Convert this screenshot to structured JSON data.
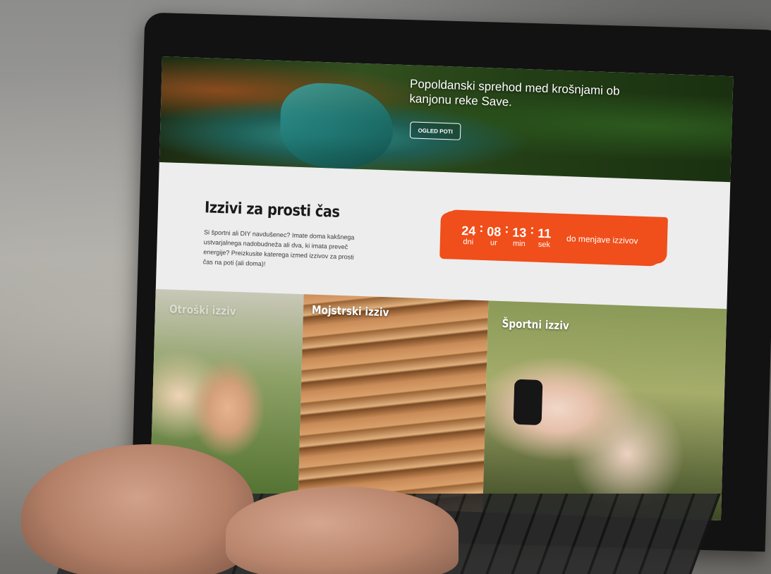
{
  "hero": {
    "title": "Popoldanski sprehod med krošnjami ob kanjonu reke Save.",
    "button_label": "OGLED POTI"
  },
  "intro": {
    "title": "Izzivi za prosti čas",
    "text": "Si športni ali DIY navdušenec? Imate doma kakšnega ustvarjalnega nadobudneža ali dva, ki imata preveč energije? Preizkusite katerega izmed izzivov za prosti čas na poti (ali doma)!"
  },
  "countdown": {
    "days": "24",
    "days_label": "dni",
    "hours": "08",
    "hours_label": "ur",
    "minutes": "13",
    "minutes_label": "min",
    "seconds": "11",
    "seconds_label": "sek",
    "separator": ":",
    "caption": "do menjave izzivov",
    "color": "#f04e1a"
  },
  "cards": [
    {
      "label": "Otroški izziv"
    },
    {
      "label": "Mojstrski izziv"
    },
    {
      "label": "Športni izziv"
    }
  ]
}
